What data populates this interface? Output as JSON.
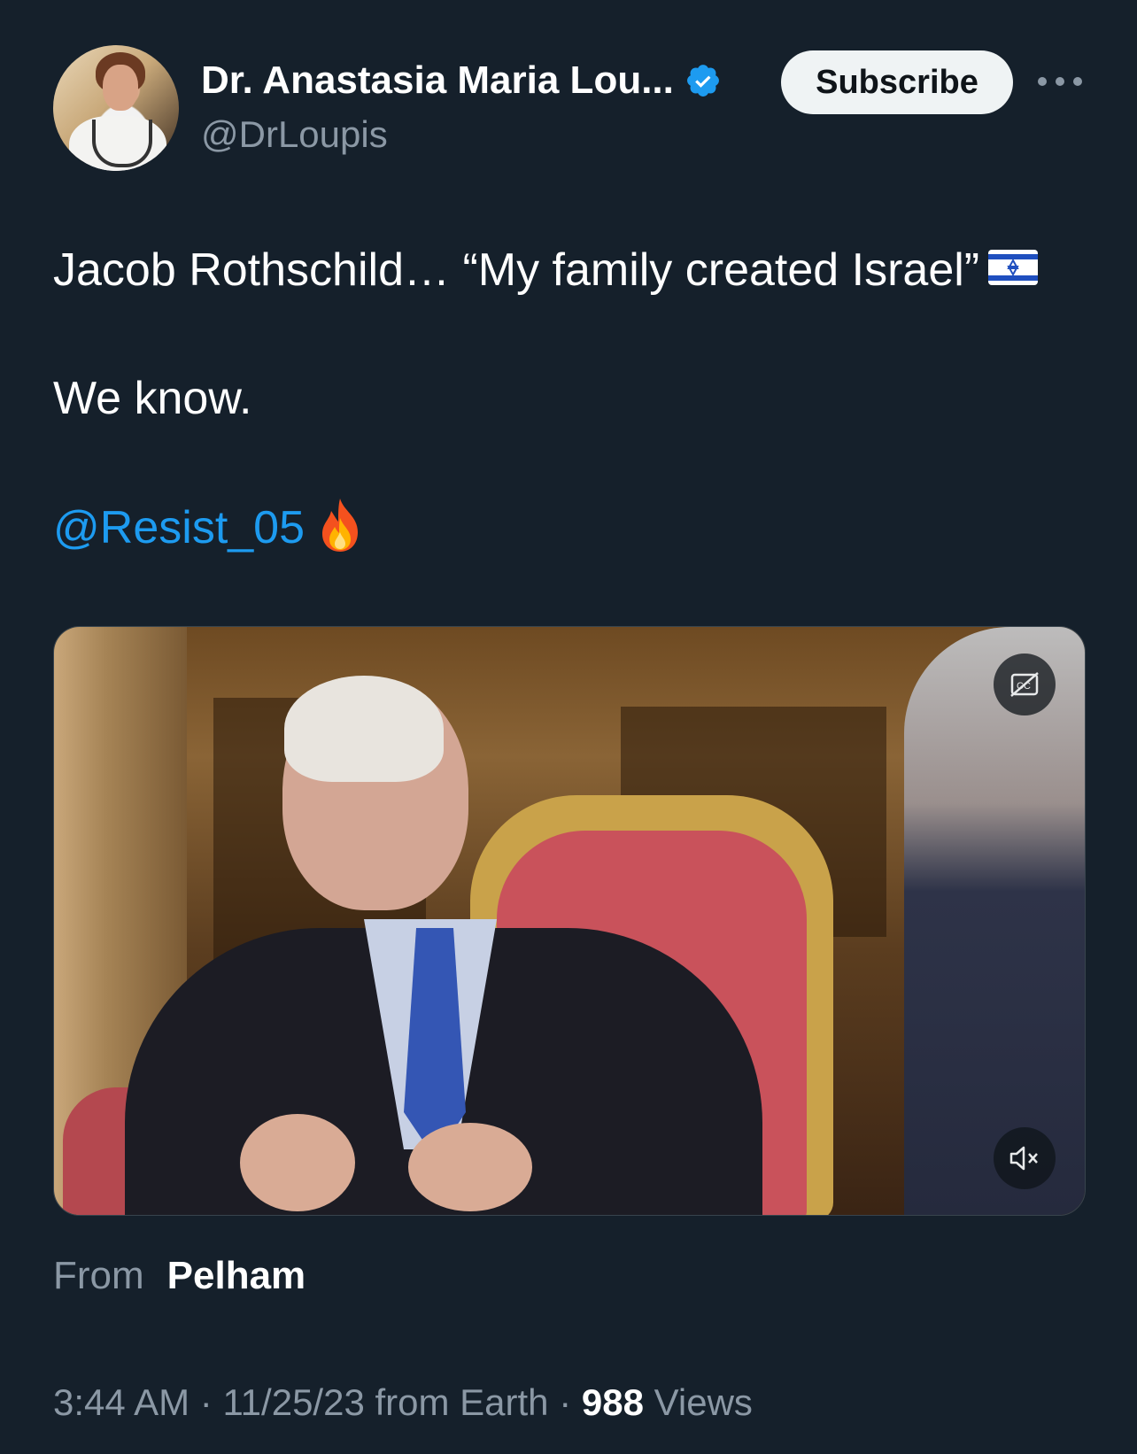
{
  "author": {
    "display_name": "Dr. Anastasia Maria Lou...",
    "handle": "@DrLoupis",
    "verified": true,
    "avatar_icon": "profile-photo"
  },
  "header": {
    "subscribe_label": "Subscribe",
    "more_icon": "more-horizontal-icon"
  },
  "tweet": {
    "line1": "Jacob Rothschild… “My family created Israel”",
    "line1_emoji": "israel-flag",
    "line2": "We know.",
    "mention": "@Resist_05",
    "mention_emoji": "fire"
  },
  "media": {
    "type": "video",
    "controls": [
      "captions-off-icon",
      "muted-speaker-icon"
    ]
  },
  "source": {
    "from_label": "From",
    "place": "Pelham"
  },
  "meta": {
    "time": "3:44 AM",
    "sep1": " · ",
    "date": "11/25/23",
    "client": " from Earth",
    "sep2": " · ",
    "views_count": "988",
    "views_label": " Views"
  },
  "colors": {
    "background": "#15202b",
    "accent": "#1d9bf0",
    "muted_text": "#8b98a5",
    "button_bg": "#eff3f4"
  }
}
